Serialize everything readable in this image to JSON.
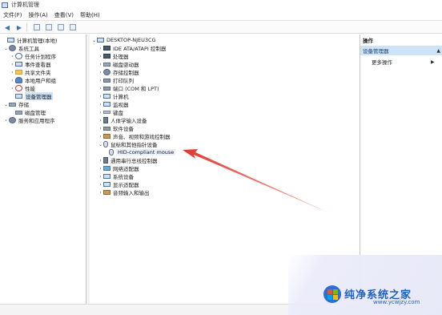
{
  "window": {
    "title": "计算机管理"
  },
  "menu": [
    "文件(F)",
    "操作(A)",
    "查看(V)",
    "帮助(H)"
  ],
  "left_tree": [
    {
      "label": "计算机管理(本地)",
      "icon": "computer-icon",
      "chev": ""
    },
    {
      "label": "系统工具",
      "icon": "tools-icon",
      "chev": "v"
    },
    {
      "label": "任务计划程序",
      "icon": "clock-icon",
      "chev": ">"
    },
    {
      "label": "事件查看器",
      "icon": "event-viewer-icon",
      "chev": ">"
    },
    {
      "label": "共享文件夹",
      "icon": "folder-icon",
      "chev": ">"
    },
    {
      "label": "本地用户和组",
      "icon": "users-icon",
      "chev": ">"
    },
    {
      "label": "性能",
      "icon": "performance-icon",
      "chev": ">"
    },
    {
      "label": "设备管理器",
      "icon": "device-manager-icon",
      "chev": ""
    },
    {
      "label": "存储",
      "icon": "storage-icon",
      "chev": "v"
    },
    {
      "label": "磁盘管理",
      "icon": "disk-icon",
      "chev": ""
    },
    {
      "label": "服务和应用程序",
      "icon": "services-icon",
      "chev": ">"
    }
  ],
  "device_tree": {
    "root": "DESKTOP-NJEU3CG",
    "items": [
      {
        "label": "IDE ATA/ATAPI 控制器",
        "icon": "ide-controller-icon"
      },
      {
        "label": "处理器",
        "icon": "processor-icon"
      },
      {
        "label": "磁盘驱动器",
        "icon": "disk-drive-icon"
      },
      {
        "label": "存储控制器",
        "icon": "storage-controller-icon"
      },
      {
        "label": "打印队列",
        "icon": "printer-icon"
      },
      {
        "label": "端口 (COM 和 LPT)",
        "icon": "port-icon"
      },
      {
        "label": "计算机",
        "icon": "computer-icon"
      },
      {
        "label": "监视器",
        "icon": "monitor-icon"
      },
      {
        "label": "键盘",
        "icon": "keyboard-icon"
      },
      {
        "label": "人体学输入设备",
        "icon": "hid-icon"
      },
      {
        "label": "软件设备",
        "icon": "software-device-icon"
      },
      {
        "label": "声音、视频和游戏控制器",
        "icon": "sound-icon"
      },
      {
        "label": "鼠标和其他指针设备",
        "icon": "mouse-icon"
      },
      {
        "label": "HID-compliant mouse",
        "icon": "mouse-icon"
      },
      {
        "label": "通用串行总线控制器",
        "icon": "usb-icon"
      },
      {
        "label": "网络适配器",
        "icon": "network-adapter-icon"
      },
      {
        "label": "系统设备",
        "icon": "system-device-icon"
      },
      {
        "label": "显示适配器",
        "icon": "display-adapter-icon"
      },
      {
        "label": "音频输入和输出",
        "icon": "audio-icon"
      }
    ]
  },
  "actions": {
    "header": "操作",
    "section": "设备管理器",
    "more": "更多操作"
  },
  "watermark": {
    "title": "纯净系统之家",
    "url": "www.ycwjzy.com"
  },
  "colors": {
    "selection": "#cde3f7",
    "arrow": "#e03b2f",
    "watermark_blue": "#1f5fc4"
  }
}
